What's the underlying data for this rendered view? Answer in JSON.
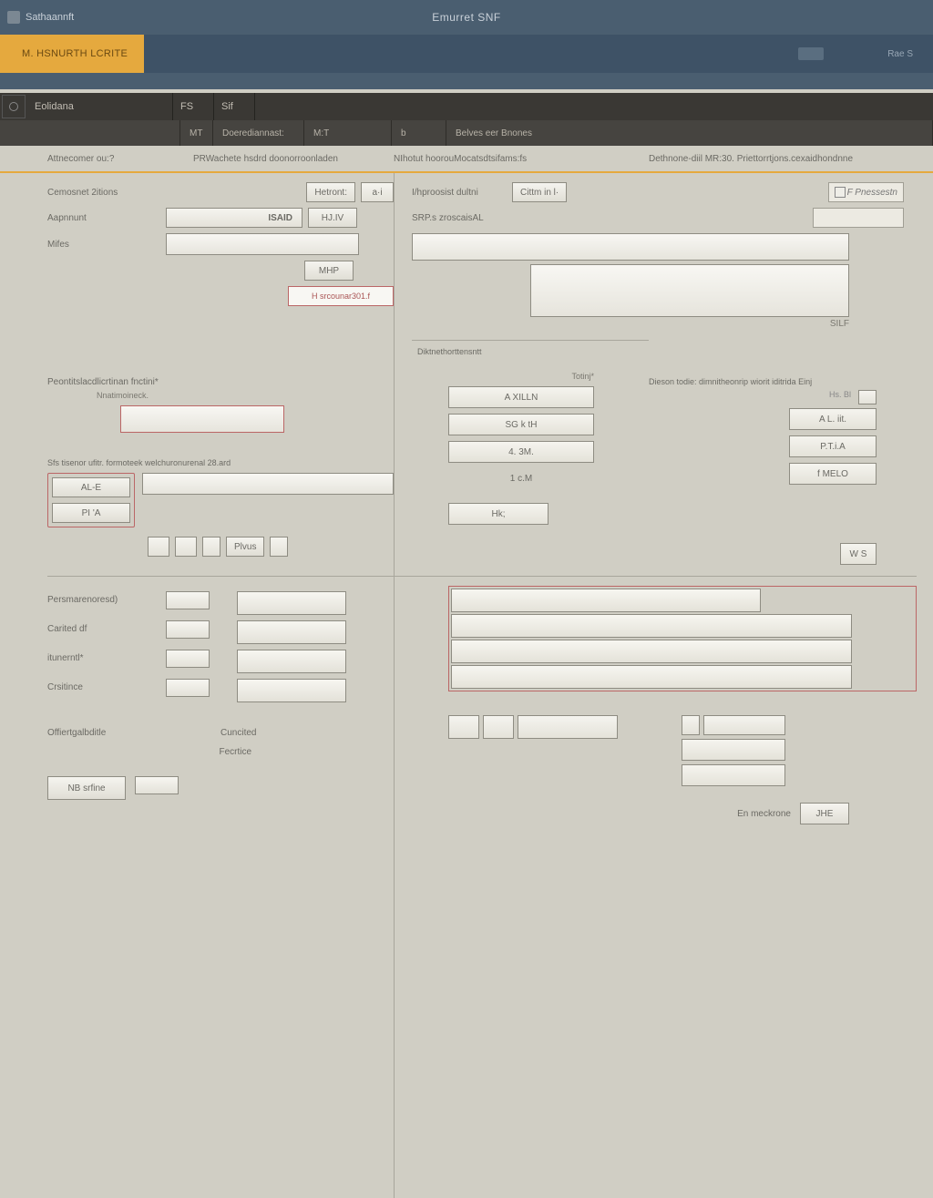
{
  "titlebar": {
    "left": "Sathaannft",
    "center": "Emurret SNF"
  },
  "bar2": {
    "tab_line1": "M. HSNURTH LCRITE",
    "tab_line2": "                ",
    "right_text": "Rae S"
  },
  "nav": {
    "item": "Eolidana",
    "n2": "FS",
    "n3": "Sif"
  },
  "subnav": {
    "c1": "MT",
    "c2": "Doerediannast:",
    "c3": "M:T",
    "c4": "b",
    "c5": "Belves eer Bnones"
  },
  "crumbs": {
    "c1": "Attnecomer ou:?",
    "c2": "PRWachete hsdrd doonorroonladen",
    "c3": "NIhotut hoorouMocatsdtsifams:fs",
    "c4": "Dethnone-diil MR:30. Priettorrtjons.cexaidhondnne"
  },
  "leftTop": {
    "l1": "Cemosnet 2itions",
    "l1_btn": "Hetront:",
    "l1_chip": "a·i",
    "l2": "Aapnnunt",
    "l2_val": "ISAID",
    "l2_btn": "HJ.IV",
    "l3": "Mifes",
    "l3_btn": "MHP",
    "l3_note": "H srcounar301.f"
  },
  "rightTop": {
    "l1": "I/hproosist dultni",
    "l1_btn": "Cittm  in  l·",
    "l2": "SRP.s zroscaisAL",
    "l2_chip": "F   Pnessestn",
    "r_footer": "SILF"
  },
  "fs1": {
    "legend": "Diktnethorttensntt"
  },
  "fs2": {
    "title": "Peontitslacdlicrtinan fnctini*",
    "sub": "Nnatimoineck.",
    "foot": "Sfs tisenor ufitr. formoteek welchuronurenal 28.ard",
    "stackR": [
      "Totinj*",
      "A     XILLN",
      "SG   k tH",
      "4.    3M.",
      "1    c.M"
    ],
    "stackR2_title": "Dieson todie:  dimnitheonrip wiorit iditrida  Einj",
    "stackR2_chips": [
      "Hs.      Bl",
      "A  L. iit.",
      "P.T.i.A",
      "f   MELO"
    ],
    "chipA": "AL-E",
    "chipB": "PI  'A",
    "mid_btn": "Plvus",
    "mid_val": "Hk;"
  },
  "bot": {
    "rows": [
      "Persmarenoresd)",
      "Carited df",
      "itunerntl*",
      "Crsitince"
    ],
    "r5": "Offiertgalbditle",
    "r5b": "Cuncited",
    "r6": "Fecrtice",
    "btn": "NB srfine"
  },
  "rightBot": {
    "chip1": "W S",
    "vals": [
      "",
      "",
      ""
    ],
    "mini": [
      "",
      "",
      ""
    ],
    "lbl": "En meckrone",
    "btn": "JHE"
  }
}
